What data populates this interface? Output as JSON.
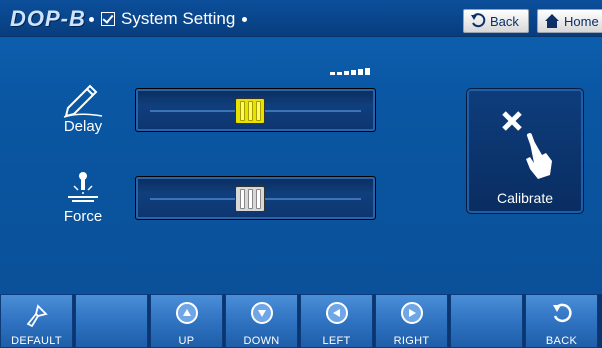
{
  "header": {
    "brand": "DOP-B",
    "title": "System Setting",
    "back_label": "Back",
    "home_label": "Home"
  },
  "sliders": {
    "delay": {
      "label": "Delay",
      "value_fraction": 0.47,
      "thumb_color": "#e8e200"
    },
    "force": {
      "label": "Force",
      "value_fraction": 0.47,
      "thumb_color": "#d8d8d8"
    }
  },
  "level_indicator": {
    "bars": 6,
    "active": 6
  },
  "calibrate": {
    "label": "Calibrate"
  },
  "bottom_buttons": [
    {
      "label": "DEFAULT",
      "icon": "brush-icon"
    },
    {
      "label": "",
      "icon": ""
    },
    {
      "label": "UP",
      "icon": "arrow-up-icon"
    },
    {
      "label": "DOWN",
      "icon": "arrow-down-icon"
    },
    {
      "label": "LEFT",
      "icon": "arrow-left-icon"
    },
    {
      "label": "RIGHT",
      "icon": "arrow-right-icon"
    },
    {
      "label": "",
      "icon": ""
    },
    {
      "label": "BACK",
      "icon": "back-icon"
    }
  ],
  "colors": {
    "accent": "#0a56a2",
    "title_bar": "#083d7e",
    "bottom_button": "#2f73c2"
  }
}
